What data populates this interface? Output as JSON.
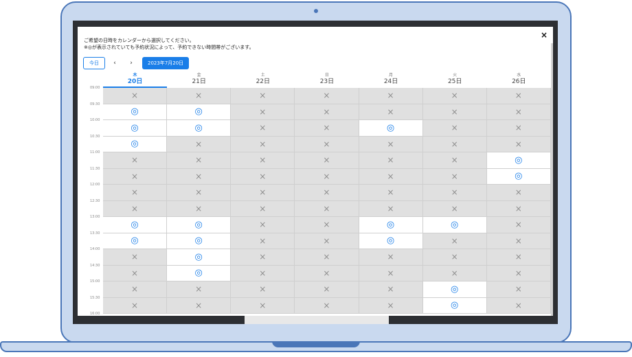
{
  "modal": {
    "close_icon": "×",
    "instructions": [
      "ご希望の日時をカレンダーから選択してください。",
      "※◎が表示されていても予約状況によって、予約できない時間帯がございます。"
    ]
  },
  "nav": {
    "today": "今日",
    "prev_icon": "‹",
    "next_icon": "›",
    "date_button": "2023年7月20日"
  },
  "days": [
    {
      "weekday": "木",
      "date": "20日",
      "active": true
    },
    {
      "weekday": "金",
      "date": "21日",
      "active": false
    },
    {
      "weekday": "土",
      "date": "22日",
      "active": false
    },
    {
      "weekday": "日",
      "date": "23日",
      "active": false
    },
    {
      "weekday": "月",
      "date": "24日",
      "active": false
    },
    {
      "weekday": "火",
      "date": "25日",
      "active": false
    },
    {
      "weekday": "水",
      "date": "26日",
      "active": false
    }
  ],
  "times": [
    "09:00",
    "09:30",
    "10:00",
    "10:30",
    "11:00",
    "11:30",
    "12:00",
    "12:30",
    "13:00",
    "13:30",
    "14:00",
    "14:30",
    "15:00",
    "15:30",
    "16:00"
  ],
  "symbols": {
    "available": "◎",
    "unavailable": "×"
  },
  "availability": [
    [
      "x",
      "x",
      "x",
      "x",
      "x",
      "x",
      "x"
    ],
    [
      "o",
      "o",
      "x",
      "x",
      "x",
      "x",
      "x"
    ],
    [
      "o",
      "o",
      "x",
      "x",
      "o",
      "x",
      "x"
    ],
    [
      "o",
      "x",
      "x",
      "x",
      "x",
      "x",
      "x"
    ],
    [
      "x",
      "x",
      "x",
      "x",
      "x",
      "x",
      "o"
    ],
    [
      "x",
      "x",
      "x",
      "x",
      "x",
      "x",
      "o"
    ],
    [
      "x",
      "x",
      "x",
      "x",
      "x",
      "x",
      "x"
    ],
    [
      "x",
      "x",
      "x",
      "x",
      "x",
      "x",
      "x"
    ],
    [
      "o",
      "o",
      "x",
      "x",
      "o",
      "o",
      "x"
    ],
    [
      "o",
      "o",
      "x",
      "x",
      "o",
      "x",
      "x"
    ],
    [
      "x",
      "o",
      "x",
      "x",
      "x",
      "x",
      "x"
    ],
    [
      "x",
      "o",
      "x",
      "x",
      "x",
      "x",
      "x"
    ],
    [
      "x",
      "x",
      "x",
      "x",
      "x",
      "o",
      "x"
    ],
    [
      "x",
      "x",
      "x",
      "x",
      "x",
      "o",
      "x"
    ]
  ]
}
